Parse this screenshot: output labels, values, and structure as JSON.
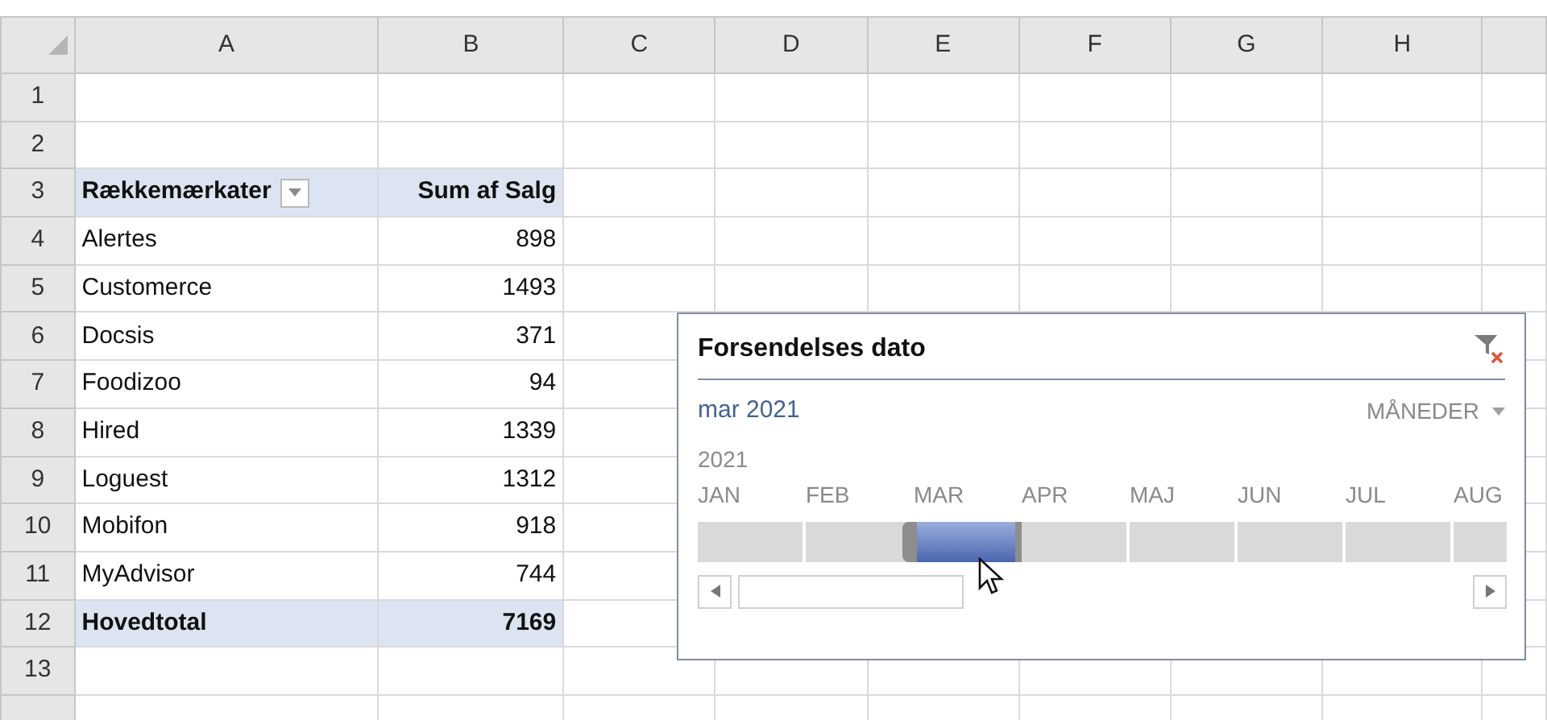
{
  "column_headers": [
    "A",
    "B",
    "C",
    "D",
    "E",
    "F",
    "G",
    "H"
  ],
  "row_headers": [
    "1",
    "2",
    "3",
    "4",
    "5",
    "6",
    "7",
    "8",
    "9",
    "10",
    "11",
    "12",
    "13"
  ],
  "pivot": {
    "row_labels_header": "Rækkemærkater",
    "value_header": "Sum af Salg",
    "rows": [
      {
        "label": "Alertes",
        "value": "898"
      },
      {
        "label": "Customerce",
        "value": "1493"
      },
      {
        "label": "Docsis",
        "value": "371"
      },
      {
        "label": "Foodizoo",
        "value": "94"
      },
      {
        "label": "Hired",
        "value": "1339"
      },
      {
        "label": "Loguest",
        "value": "1312"
      },
      {
        "label": "Mobifon",
        "value": "918"
      },
      {
        "label": "MyAdvisor",
        "value": "744"
      }
    ],
    "total": {
      "label": "Hovedtotal",
      "value": "7169"
    }
  },
  "timeline": {
    "title": "Forsendelses dato",
    "selection_label": "mar 2021",
    "level_selector": "MÅNEDER",
    "year": "2021",
    "months": [
      {
        "label": "JAN",
        "selected": false
      },
      {
        "label": "FEB",
        "selected": false
      },
      {
        "label": "MAR",
        "selected": true
      },
      {
        "label": "APR",
        "selected": false
      },
      {
        "label": "MAJ",
        "selected": false
      },
      {
        "label": "JUN",
        "selected": false
      },
      {
        "label": "JUL",
        "selected": false
      },
      {
        "label": "AUG",
        "selected": false
      }
    ]
  }
}
